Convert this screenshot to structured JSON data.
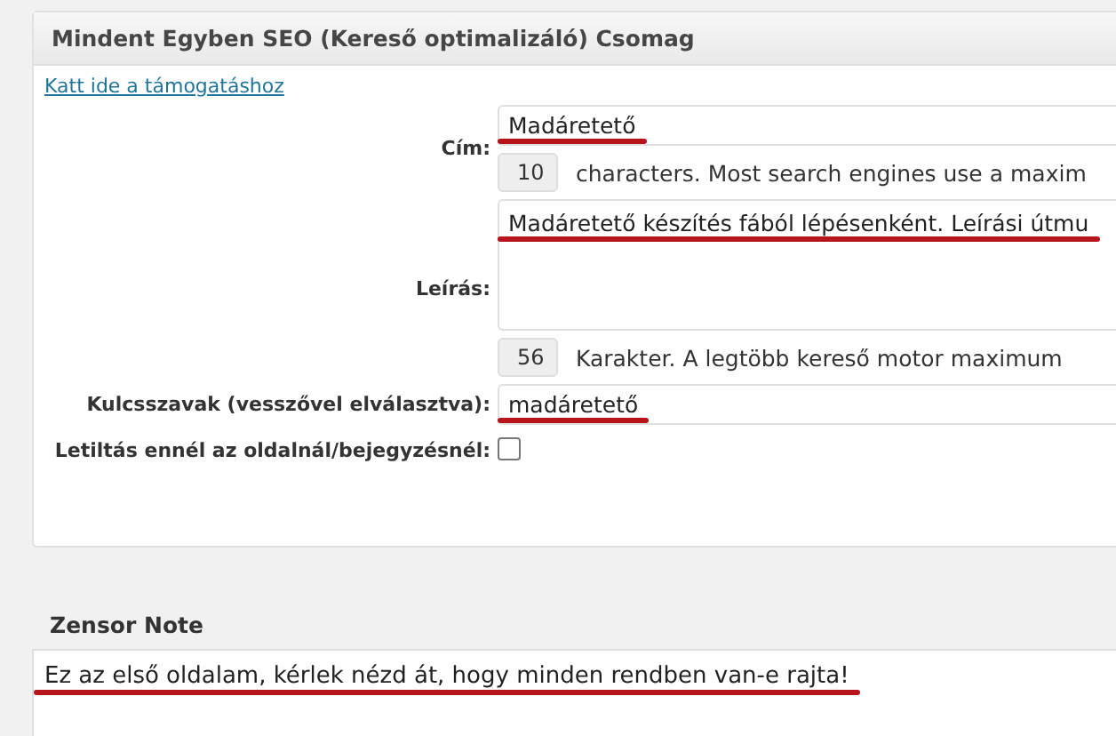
{
  "panel": {
    "title": "Mindent Egyben SEO (Kereső optimalizáló) Csomag",
    "support_link": "Katt ide a támogatáshoz",
    "fields": [
      {
        "kind": "input",
        "label": "Cím:",
        "value": "Madáretető",
        "annotated": true,
        "counter": "10",
        "counter_note": "characters. Most search engines use a maxim"
      },
      {
        "kind": "textarea",
        "label": "Leírás:",
        "value": "Madáretető készítés fából lépésenként. Leírási útmu",
        "annotated": true,
        "counter": "56",
        "counter_note": "Karakter. A legtöbb kereső motor maximum"
      },
      {
        "kind": "input",
        "label": "Kulcsszavak (vesszővel elválasztva):",
        "value": "madáretető",
        "annotated": true
      },
      {
        "kind": "checkbox",
        "label": "Letiltás ennél az oldalnál/bejegyzésnél:",
        "checked": false
      }
    ]
  },
  "note": {
    "title": "Zensor Note",
    "value": "Ez az első oldalam, kérlek nézd át, hogy minden rendben van-e rajta!",
    "annotated": true
  }
}
